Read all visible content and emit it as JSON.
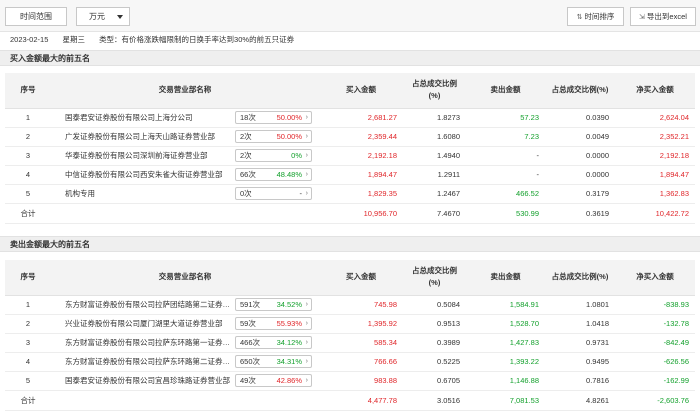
{
  "toolbar": {
    "time_range": "时间范围",
    "unit": "万元",
    "sort_label": "时间排序",
    "export_label": "导出到excel"
  },
  "info": {
    "date": "2023-02-15",
    "weekday": "星期三",
    "type": "类型：有价格涨跌幅限制的日换手率达到30%的前五只证券"
  },
  "buy_section": {
    "title": "买入金额最大的前五名",
    "headers": [
      "序号",
      "交易营业部名称",
      "买入金额",
      "占总成交比例(%)",
      "卖出金额",
      "占总成交比例(%)",
      "净买入金额"
    ],
    "rows": [
      {
        "no": "1",
        "name": "国泰君安证券股份有限公司上海分公司",
        "times": "18次",
        "pct": "50.00%",
        "pct_color": "red",
        "buy": "2,681.27",
        "buy_ratio": "1.8273",
        "sell": "57.23",
        "sell_ratio": "0.0390",
        "net": "2,624.04",
        "net_color": "red"
      },
      {
        "no": "2",
        "name": "广发证券股份有限公司上海天山路证券营业部",
        "times": "2次",
        "pct": "50.00%",
        "pct_color": "red",
        "buy": "2,359.44",
        "buy_ratio": "1.6080",
        "sell": "7.23",
        "sell_ratio": "0.0049",
        "net": "2,352.21",
        "net_color": "red"
      },
      {
        "no": "3",
        "name": "华泰证券股份有限公司深圳前海证券营业部",
        "times": "2次",
        "pct": "0%",
        "pct_color": "green",
        "buy": "2,192.18",
        "buy_ratio": "1.4940",
        "sell": "-",
        "sell_ratio": "0.0000",
        "net": "2,192.18",
        "net_color": "red"
      },
      {
        "no": "4",
        "name": "中信证券股份有限公司西安朱雀大街证券营业部",
        "times": "66次",
        "pct": "48.48%",
        "pct_color": "green",
        "buy": "1,894.47",
        "buy_ratio": "1.2911",
        "sell": "-",
        "sell_ratio": "0.0000",
        "net": "1,894.47",
        "net_color": "red"
      },
      {
        "no": "5",
        "name": "机构专用",
        "times": "0次",
        "pct": "-",
        "pct_color": "black",
        "buy": "1,829.35",
        "buy_ratio": "1.2467",
        "sell": "466.52",
        "sell_ratio": "0.3179",
        "net": "1,362.83",
        "net_color": "red"
      }
    ],
    "total": {
      "label": "合计",
      "buy": "10,956.70",
      "buy_ratio": "7.4670",
      "sell": "530.99",
      "sell_ratio": "0.3619",
      "net": "10,422.72"
    }
  },
  "sell_section": {
    "title": "卖出金额最大的前五名",
    "headers": [
      "序号",
      "交易营业部名称",
      "买入金额",
      "占总成交比例(%)",
      "卖出金额",
      "占总成交比例(%)",
      "净买入金额"
    ],
    "rows": [
      {
        "no": "1",
        "name": "东方财富证券股份有限公司拉萨团结路第二证券…",
        "times": "591次",
        "pct": "34.52%",
        "pct_color": "green",
        "buy": "745.98",
        "buy_ratio": "0.5084",
        "sell": "1,584.91",
        "sell_ratio": "1.0801",
        "net": "-838.93",
        "net_color": "green"
      },
      {
        "no": "2",
        "name": "兴业证券股份有限公司厦门湖里大道证券营业部",
        "times": "59次",
        "pct": "55.93%",
        "pct_color": "red",
        "buy": "1,395.92",
        "buy_ratio": "0.9513",
        "sell": "1,528.70",
        "sell_ratio": "1.0418",
        "net": "-132.78",
        "net_color": "green"
      },
      {
        "no": "3",
        "name": "东方财富证券股份有限公司拉萨东环路第一证券…",
        "times": "466次",
        "pct": "34.12%",
        "pct_color": "green",
        "buy": "585.34",
        "buy_ratio": "0.3989",
        "sell": "1,427.83",
        "sell_ratio": "0.9731",
        "net": "-842.49",
        "net_color": "green"
      },
      {
        "no": "4",
        "name": "东方财富证券股份有限公司拉萨东环路第二证券…",
        "times": "650次",
        "pct": "34.31%",
        "pct_color": "green",
        "buy": "766.66",
        "buy_ratio": "0.5225",
        "sell": "1,393.22",
        "sell_ratio": "0.9495",
        "net": "-626.56",
        "net_color": "green"
      },
      {
        "no": "5",
        "name": "国泰君安证券股份有限公司宜昌珍珠路证券营业部",
        "times": "49次",
        "pct": "42.86%",
        "pct_color": "red",
        "buy": "983.88",
        "buy_ratio": "0.6705",
        "sell": "1,146.88",
        "sell_ratio": "0.7816",
        "net": "-162.99",
        "net_color": "green"
      }
    ],
    "total": {
      "label": "合计",
      "buy": "4,477.78",
      "buy_ratio": "3.0516",
      "sell": "7,081.53",
      "sell_ratio": "4.8261",
      "net": "-2,603.76"
    }
  },
  "colors": {
    "up": "#e0262a",
    "down": "#13a02c",
    "header_bg": "#f3f3f3"
  },
  "icons": {
    "sort": "sort-arrows-icon",
    "export": "export-icon",
    "unit_dropdown": "chevron-down-icon",
    "row_arrow": "chevron-right-icon"
  }
}
